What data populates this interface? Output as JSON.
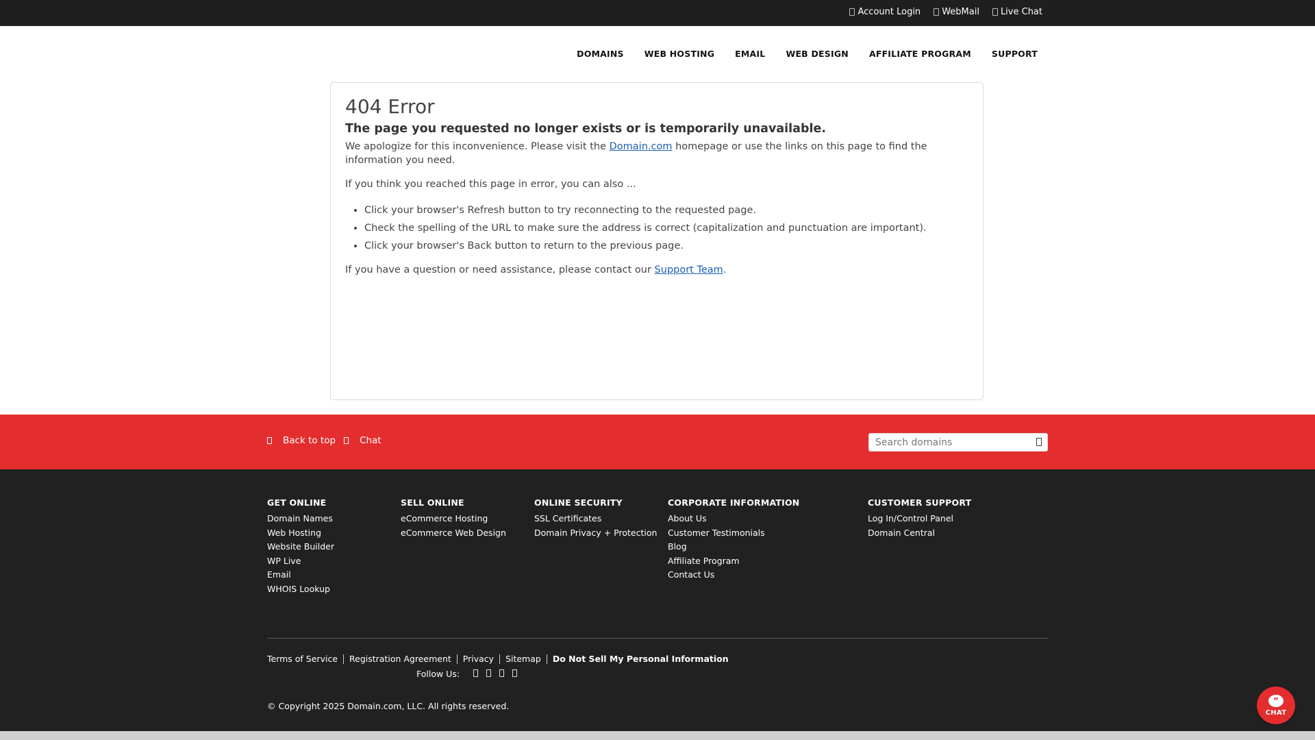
{
  "topbar": {
    "links": [
      {
        "label": "Account Login"
      },
      {
        "label": "WebMail"
      },
      {
        "label": "Live Chat"
      }
    ]
  },
  "nav": {
    "items": [
      "DOMAINS",
      "WEB HOSTING",
      "EMAIL",
      "WEB DESIGN",
      "AFFILIATE PROGRAM",
      "SUPPORT"
    ]
  },
  "content": {
    "title": "404 Error",
    "subtitle": "The page you requested no longer exists or is temporarily unavailable.",
    "p1_before": "We apologize for this inconvenience. Please visit the ",
    "p1_link": "Domain.com",
    "p1_after": " homepage or use the links on this page to find the information you need.",
    "p2": "If you think you reached this page in error, you can also ...",
    "bullets": [
      "Click your browser's Refresh button to try reconnecting to the requested page.",
      "Check the spelling of the URL to make sure the address is correct (capitalization and punctuation are important).",
      "Click your browser's Back button to return to the previous page."
    ],
    "p3_before": "If you have a question or need assistance, please contact our ",
    "p3_link": "Support Team",
    "p3_after": "."
  },
  "redbar": {
    "back_to_top": "Back to top",
    "chat": "Chat",
    "search_placeholder": "Search domains"
  },
  "footer": {
    "columns": [
      {
        "heading": "GET ONLINE",
        "links": [
          "Domain Names",
          "Web Hosting",
          "Website Builder",
          "WP Live",
          "Email",
          "WHOIS Lookup"
        ]
      },
      {
        "heading": "SELL ONLINE",
        "links": [
          "eCommerce Hosting",
          "eCommerce Web Design"
        ]
      },
      {
        "heading": "ONLINE SECURITY",
        "links": [
          "SSL Certificates",
          "Domain Privacy + Protection"
        ]
      },
      {
        "heading": "CORPORATE INFORMATION",
        "links": [
          "About Us",
          "Customer Testimonials",
          "Blog",
          "Affiliate Program",
          "Contact Us"
        ]
      },
      {
        "heading": "CUSTOMER SUPPORT",
        "links": [
          "Log In/Control Panel",
          "Domain Central"
        ]
      }
    ],
    "legal": [
      "Terms of Service",
      "Registration Agreement",
      "Privacy",
      "Sitemap",
      "Do Not Sell My Personal Information"
    ],
    "follow_label": "Follow Us:",
    "copyright": "© Copyright  2025 Domain.com, LLC. All rights reserved."
  },
  "chat_widget": {
    "label": "CHAT"
  },
  "colors": {
    "brand_red": "#e42d2e",
    "topbar": "#1f1f1f",
    "footer": "#212121",
    "link": "#1a5fb4"
  }
}
